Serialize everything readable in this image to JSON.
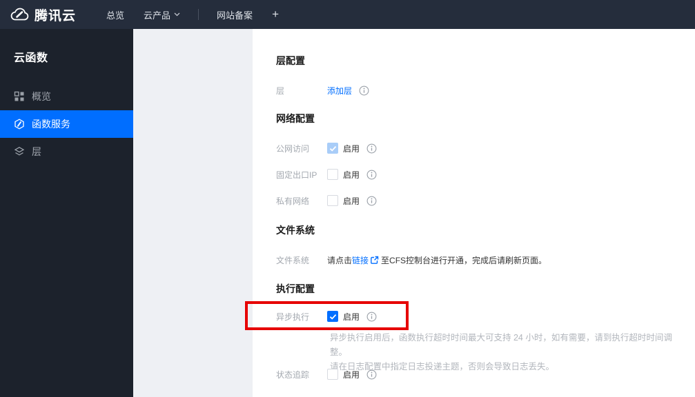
{
  "topbar": {
    "brand": "腾讯云",
    "nav": [
      {
        "label": "总览"
      },
      {
        "label": "云产品"
      },
      {
        "label": "网站备案"
      },
      {
        "label": "+"
      }
    ]
  },
  "sidebar": {
    "title": "云函数",
    "items": [
      {
        "label": "概览",
        "icon": "grid-icon",
        "active": false
      },
      {
        "label": "函数服务",
        "icon": "function-icon",
        "active": true
      },
      {
        "label": "层",
        "icon": "layers-icon",
        "active": false
      }
    ]
  },
  "main": {
    "layer_config": {
      "title": "层配置",
      "layer_label": "层",
      "add_layer_link": "添加层"
    },
    "network_config": {
      "title": "网络配置",
      "rows": [
        {
          "label": "公网访问",
          "enable_label": "启用",
          "checkbox_state": "checked-disabled"
        },
        {
          "label": "固定出口IP",
          "enable_label": "启用",
          "checkbox_state": "unchecked"
        },
        {
          "label": "私有网络",
          "enable_label": "启用",
          "checkbox_state": "unchecked"
        }
      ]
    },
    "file_system": {
      "title": "文件系统",
      "label": "文件系统",
      "text_before": "请点击",
      "link_text": "链接",
      "text_after": "至CFS控制台进行开通，完成后请刷新页面。"
    },
    "execution_config": {
      "title": "执行配置",
      "async_row": {
        "label": "异步执行",
        "enable_label": "启用",
        "checkbox_state": "checked"
      },
      "async_hint_line1": "异步执行启用后，函数执行超时时间最大可支持 24 小时，如有需要，请到执行超时时间调整。",
      "async_hint_line2": "请在日志配置中指定日志投递主题，否则会导致日志丢失。",
      "status_row": {
        "label": "状态追踪",
        "enable_label": "启用",
        "checkbox_state": "unchecked"
      }
    }
  },
  "colors": {
    "accent_blue": "#006eff",
    "topbar_bg": "#252d3c",
    "sidebar_bg": "#1c222c",
    "gray_panel": "#eef0f4",
    "annotation_red": "#e60000",
    "disabled_check_blue": "#a9cdf8"
  }
}
